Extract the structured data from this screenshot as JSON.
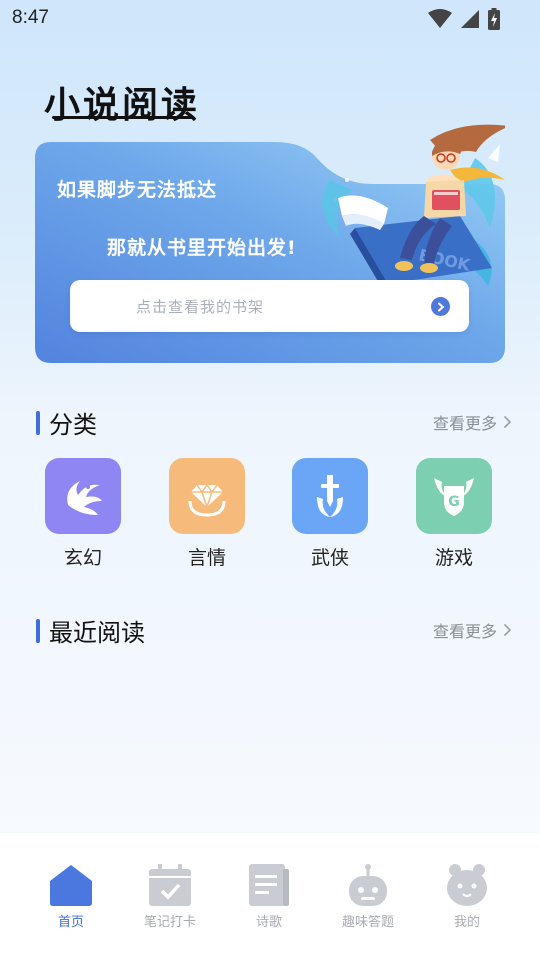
{
  "status_bar": {
    "time": "8:47",
    "icons": [
      "wifi-icon",
      "signal-icon",
      "battery-charging-icon"
    ]
  },
  "header": {
    "title": "小说阅读"
  },
  "banner": {
    "line1": "如果脚步无法抵达",
    "line2": "那就从书里开始出发!",
    "illustration_book_text": "BOOK",
    "search_placeholder": "点击查看我的书架"
  },
  "categories_section": {
    "title": "分类",
    "more": "查看更多",
    "items": [
      {
        "label": "玄幻",
        "icon": "phoenix-icon",
        "color": "#8e86f2"
      },
      {
        "label": "言情",
        "icon": "diamond-ring-icon",
        "color": "#f6bb7a"
      },
      {
        "label": "武侠",
        "icon": "sword-icon",
        "color": "#6aa6f5"
      },
      {
        "label": "游戏",
        "icon": "game-shield-icon",
        "color": "#7ccfb1"
      }
    ]
  },
  "recent_section": {
    "title": "最近阅读",
    "more": "查看更多"
  },
  "bottom_nav": {
    "items": [
      {
        "label": "首页",
        "icon": "home-icon",
        "active": true
      },
      {
        "label": "笔记打卡",
        "icon": "calendar-check-icon",
        "active": false
      },
      {
        "label": "诗歌",
        "icon": "document-icon",
        "active": false
      },
      {
        "label": "趣味答题",
        "icon": "robot-icon",
        "active": false
      },
      {
        "label": "我的",
        "icon": "mascot-icon",
        "active": false
      }
    ]
  },
  "colors": {
    "accent": "#3d6fd8",
    "banner_start": "#5a8fe3",
    "banner_end": "#8ec7f3"
  }
}
